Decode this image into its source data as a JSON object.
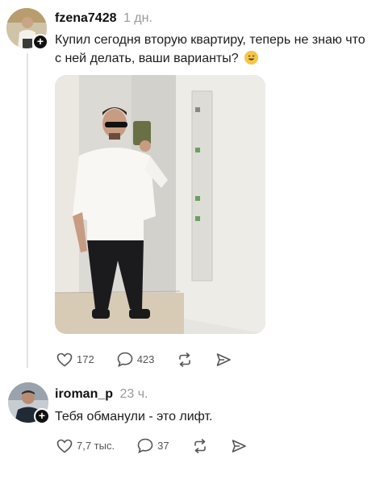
{
  "post": {
    "username": "fzena7428",
    "time": "1 дн.",
    "text": "Купил сегодня вторую квартиру, теперь не знаю что с ней делать, ваши варианты?",
    "likes": "172",
    "comments": "423"
  },
  "reply": {
    "username": "iroman_p",
    "time": "23 ч.",
    "text": "Тебя обманули - это лифт.",
    "likes": "7,7 тыс.",
    "comments": "37"
  },
  "icons": {
    "like": "heart-icon",
    "comment": "comment-icon",
    "repost": "repost-icon",
    "share": "share-icon",
    "follow": "plus-icon",
    "emoji": "grinning-sweat-emoji"
  },
  "colors": {
    "text": "#1c1c1c",
    "muted": "#9a9a9a",
    "icon": "#555555"
  }
}
